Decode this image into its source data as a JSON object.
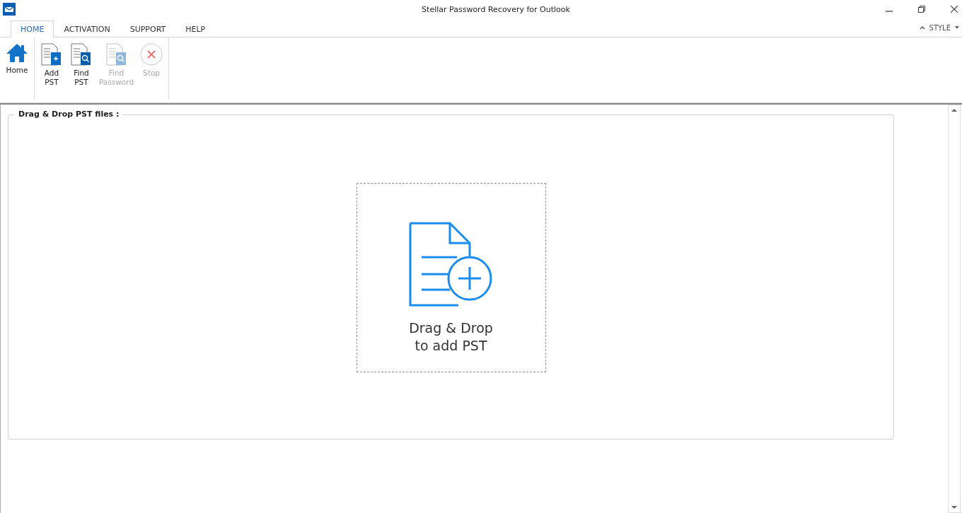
{
  "window": {
    "title": "Stellar Password Recovery for Outlook"
  },
  "tabs": [
    {
      "label": "HOME",
      "selected": true
    },
    {
      "label": "ACTIVATION",
      "selected": false
    },
    {
      "label": "SUPPORT",
      "selected": false
    },
    {
      "label": "HELP",
      "selected": false
    }
  ],
  "style_menu": {
    "label": "STYLE"
  },
  "ribbon_groups": [
    [
      {
        "kind": "home",
        "label": "Home",
        "disabled": false
      }
    ],
    [
      {
        "kind": "add",
        "label": "Add PST",
        "disabled": false
      },
      {
        "kind": "find",
        "label": "Find PST",
        "disabled": false
      },
      {
        "kind": "password",
        "label": "Find Password",
        "disabled": true
      },
      {
        "kind": "stop",
        "label": "Stop",
        "disabled": true
      }
    ]
  ],
  "panel": {
    "legend": "Drag & Drop PST files :",
    "drop_zone": {
      "line_1": "Drag & Drop",
      "line_2": "to add PST"
    }
  }
}
